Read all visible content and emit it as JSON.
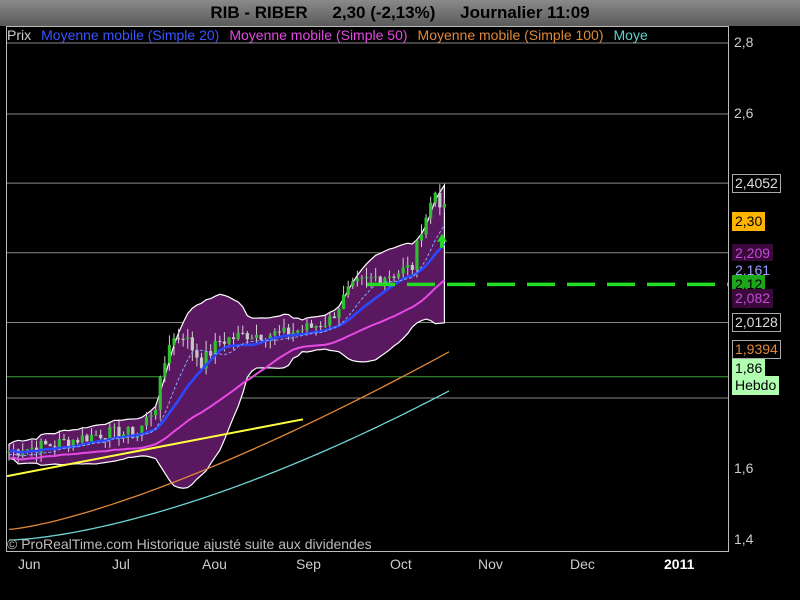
{
  "header": {
    "symbol": "RIB - RIBER",
    "price": "2,30 (-2,13%)",
    "period": "Journalier  11:09"
  },
  "legend": [
    {
      "label": "Prix",
      "color": "#cfcfcf"
    },
    {
      "label": "Moyenne mobile (Simple 20)",
      "color": "#3a54ff"
    },
    {
      "label": "Moyenne mobile (Simple 50)",
      "color": "#e34be3"
    },
    {
      "label": "Moyenne mobile (Simple 100)",
      "color": "#e0883a"
    },
    {
      "label": "Moye",
      "color": "#5fd0d0"
    }
  ],
  "copyright": "© ProRealTime.com Historique ajusté suite aux dividendes",
  "badges": [
    {
      "text": "2,4052",
      "bg": "#000000",
      "fg": "#dddddd",
      "border": "#aaaaaa",
      "value": 2.4052
    },
    {
      "text": "2,30",
      "bg": "#ffb400",
      "fg": "#000000",
      "border": "#ffb400",
      "value": 2.3
    },
    {
      "text": "2,209",
      "bg": "#3a0a3a",
      "fg": "#c34bd8",
      "border": "#3a0a3a",
      "value": 2.209
    },
    {
      "text": "2,161",
      "bg": "#000000",
      "fg": "#9aa0ff",
      "border": "#000000",
      "value": 2.161
    },
    {
      "text": "2,12",
      "bg": "#1aa71a",
      "fg": "#000000",
      "border": "#1aa71a",
      "value": 2.12
    },
    {
      "text": "2,082",
      "bg": "#3a0a3a",
      "fg": "#c34bd8",
      "border": "#3a0a3a",
      "value": 2.082
    },
    {
      "text": "2,0128",
      "bg": "#000000",
      "fg": "#dddddd",
      "border": "#aaaaaa",
      "value": 2.0128
    },
    {
      "text": "1,9394",
      "bg": "#000000",
      "fg": "#e0883a",
      "border": "#aaaaaa",
      "value": 1.9394
    },
    {
      "text": "1,86",
      "bg": "#b0ffb0",
      "fg": "#000000",
      "border": "#b0ffb0",
      "value": 1.86
    },
    {
      "text": "Hebdo",
      "bg": "#b0ffb0",
      "fg": "#000000",
      "border": "#b0ffb0",
      "value": 1.82
    }
  ],
  "chart_data": {
    "type": "candlestick",
    "title": "RIB - RIBER",
    "period": "Journalier",
    "ylim": [
      1.4,
      2.85
    ],
    "y_ticks": [
      "1,4",
      "1,6",
      "2,0128",
      "2,2",
      "2,4",
      "2,6",
      "2,8"
    ],
    "x_ticks": [
      "Jun",
      "Jul",
      "Aou",
      "Sep",
      "Oct",
      "Nov",
      "Dec",
      "2011"
    ],
    "horizontal_lines": [
      2.4052,
      2.209,
      2.0128,
      1.86,
      1.8
    ],
    "support_level": 2.12,
    "series": [
      {
        "name": "Prix",
        "sessions": [
          "Jun",
          "Jul",
          "Aou",
          "Sep",
          "Oct"
        ],
        "close": [
          1.65,
          1.7,
          1.76,
          1.95,
          1.97,
          2.08,
          2.2,
          2.3
        ]
      },
      {
        "name": "Moyenne mobile (Simple 20)",
        "values": [
          1.65,
          1.72,
          1.9,
          1.97,
          2.06,
          2.16
        ]
      },
      {
        "name": "Moyenne mobile (Simple 50)",
        "values": [
          1.62,
          1.66,
          1.8,
          1.95,
          2.03,
          2.08
        ]
      },
      {
        "name": "Moyenne mobile (Simple 100)",
        "values": [
          1.44,
          1.56,
          1.7,
          1.82,
          1.94
        ]
      }
    ]
  }
}
